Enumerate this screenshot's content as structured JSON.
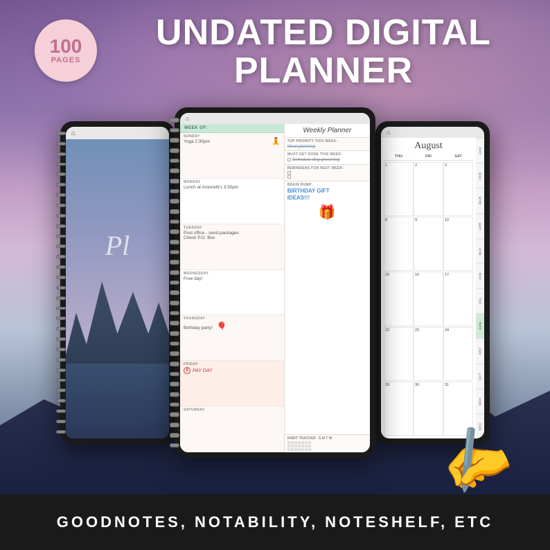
{
  "badge": {
    "number": "100",
    "pages": "PAGES"
  },
  "title": {
    "line1": "UNDATED DIGITAL",
    "line2": "PLANNER"
  },
  "bottom_bar": {
    "text": "GOODNOTES, NOTABILITY, NOTESHELF, ETC"
  },
  "cover": {
    "title_text": "Pl"
  },
  "weekly_planner": {
    "header": "Weekly Planner",
    "week_of_label": "WEEK OF:",
    "days": [
      {
        "label": "SUNDAY",
        "content": "Yoga 2:30pm"
      },
      {
        "label": "MONDAY",
        "content": "Lunch at Antonelli's 3:30pm"
      },
      {
        "label": "TUESDAY",
        "content": "Post office - send packages\nCheck P.O. Box"
      },
      {
        "label": "WEDNESDAY",
        "content": "Free day!"
      },
      {
        "label": "THURSDAY",
        "content": "Birthday party!"
      },
      {
        "label": "FRIDAY",
        "content": "PAY DAY"
      },
      {
        "label": "SATURDAY",
        "content": ""
      }
    ],
    "priorities": {
      "top_priority_label": "TOP PRIORITY THIS WEEK:",
      "top_priority": "Meal planning",
      "must_get_done_label": "MUST GET DONE THIS WEEK:",
      "must_get_done": "Schedule dog grooming",
      "reminders_label": "REMINDERS FOR NEXT WEEK:",
      "brain_dump_label": "BRAIN DUMP:",
      "brain_dump_text": "BIRTHDAY GIFT\nIDEAS!!!",
      "habit_tracker_label": "HABIT TRACKER"
    }
  },
  "monthly": {
    "month": "August",
    "day_headers": [
      "THU",
      "FRI",
      "SAT"
    ],
    "side_tabs": [
      "JAN",
      "FEB",
      "MAR",
      "APR",
      "MAY",
      "JUN",
      "JUL",
      "AUG",
      "SEP",
      "OCT",
      "NOV",
      "DEC"
    ],
    "active_tab": "AUG"
  }
}
